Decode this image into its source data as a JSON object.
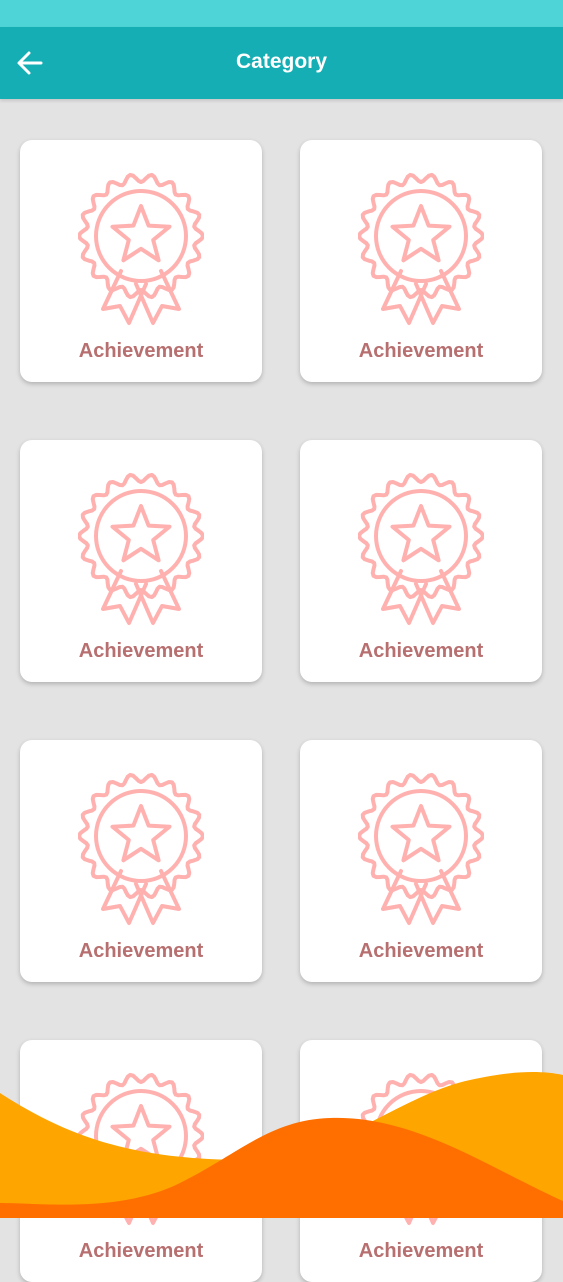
{
  "header": {
    "title": "Category",
    "back_icon": "arrow-left-icon"
  },
  "colors": {
    "status_bar": "#4ed3d6",
    "app_bar": "#14aeb4",
    "background": "#e3e3e3",
    "card_label": "#b76f6f",
    "icon_stroke": "#ffb1b0",
    "wave_orange": "#ffa500",
    "wave_dark_orange": "#ff6f00"
  },
  "categories": [
    {
      "label": "Achievement",
      "icon": "award-ribbon-icon"
    },
    {
      "label": "Achievement",
      "icon": "award-ribbon-icon"
    },
    {
      "label": "Achievement",
      "icon": "award-ribbon-icon"
    },
    {
      "label": "Achievement",
      "icon": "award-ribbon-icon"
    },
    {
      "label": "Achievement",
      "icon": "award-ribbon-icon"
    },
    {
      "label": "Achievement",
      "icon": "award-ribbon-icon"
    },
    {
      "label": "Achievement",
      "icon": "award-ribbon-icon"
    },
    {
      "label": "Achievement",
      "icon": "award-ribbon-icon"
    }
  ]
}
